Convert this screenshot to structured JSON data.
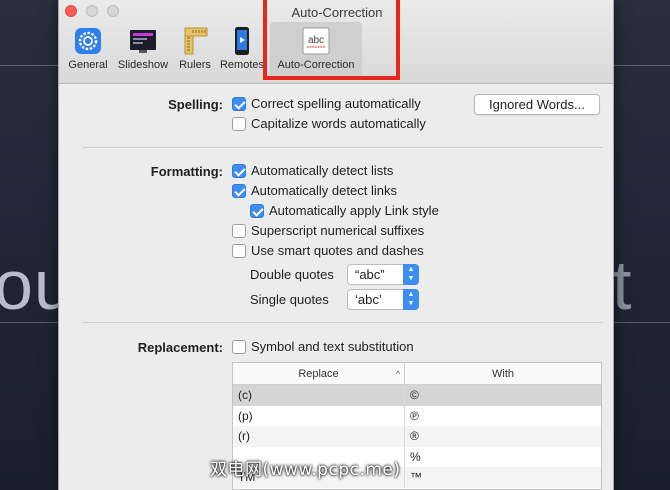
{
  "window": {
    "title": "Auto-Correction"
  },
  "background": {
    "text_left": "ou",
    "text_right": "t"
  },
  "toolbar": {
    "items": [
      {
        "label": "General",
        "icon": "gear-icon"
      },
      {
        "label": "Slideshow",
        "icon": "slideshow-icon"
      },
      {
        "label": "Rulers",
        "icon": "ruler-icon"
      },
      {
        "label": "Remotes",
        "icon": "remote-icon"
      },
      {
        "label": "Auto-Correction",
        "icon": "abc-icon",
        "selected": true
      }
    ]
  },
  "spelling": {
    "label": "Spelling:",
    "correct": {
      "label": "Correct spelling automatically",
      "checked": true
    },
    "capitalize": {
      "label": "Capitalize words automatically",
      "checked": false
    },
    "ignored_button": "Ignored Words..."
  },
  "formatting": {
    "label": "Formatting:",
    "lists": {
      "label": "Automatically detect lists",
      "checked": true
    },
    "links": {
      "label": "Automatically detect links",
      "checked": true
    },
    "link_style": {
      "label": "Automatically apply Link style",
      "checked": true
    },
    "superscript": {
      "label": "Superscript numerical suffixes",
      "checked": false
    },
    "smart_quotes": {
      "label": "Use smart quotes and dashes",
      "checked": false
    },
    "double_quotes": {
      "label": "Double quotes",
      "value": "“abc”"
    },
    "single_quotes": {
      "label": "Single quotes",
      "value": "‘abc’"
    }
  },
  "replacement": {
    "label": "Replacement:",
    "symbol": {
      "label": "Symbol and text substitution",
      "checked": false
    },
    "columns": {
      "replace": "Replace",
      "with": "With"
    },
    "rows": [
      {
        "replace": "(c)",
        "with": "©"
      },
      {
        "replace": "(p)",
        "with": "℗"
      },
      {
        "replace": "(r)",
        "with": "®"
      },
      {
        "replace": "",
        "with": "%"
      },
      {
        "replace": "TM",
        "with": "™"
      }
    ]
  },
  "watermark": "双电网(www.pcpc.me)",
  "colors": {
    "accent": "#3c8ef3",
    "highlight": "#e8261c"
  }
}
